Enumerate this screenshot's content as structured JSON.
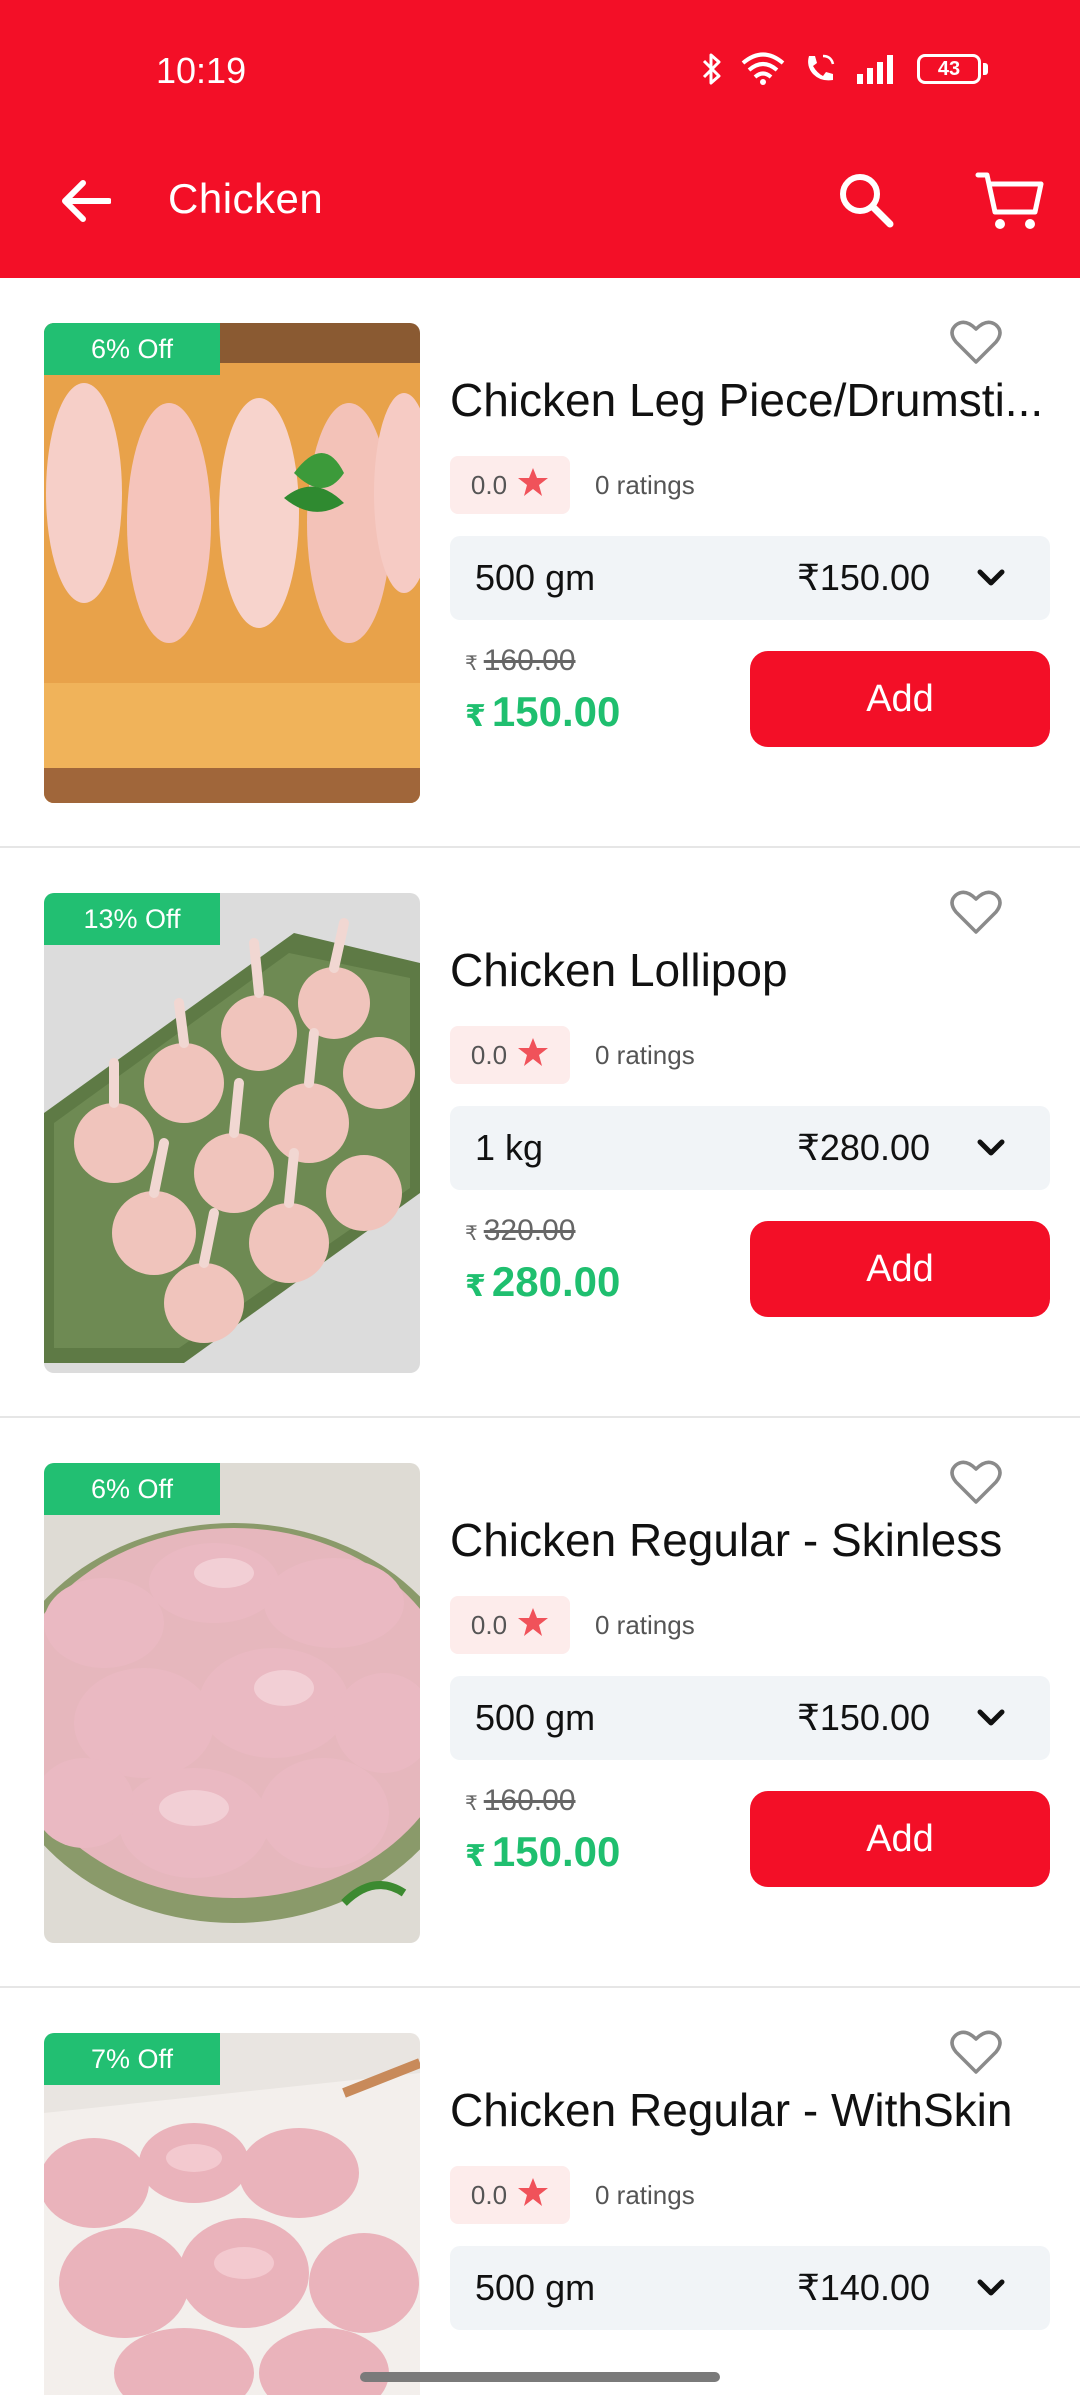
{
  "status_bar": {
    "time": "10:19",
    "battery": "43"
  },
  "toolbar": {
    "title": "Chicken"
  },
  "colors": {
    "brand": "#f30f27",
    "discount_badge": "#22bf72",
    "price_green": "#1fbf6f"
  },
  "products": [
    {
      "discount": "6% Off",
      "name": "Chicken Leg Piece/Drumsti...",
      "rating": "0.0",
      "ratings_label": "0 ratings",
      "variant_size": "500 gm",
      "variant_price": "₹150.00",
      "currency": "₹",
      "mrp": "160.00",
      "price": "150.00",
      "add_label": "Add"
    },
    {
      "discount": "13% Off",
      "name": "Chicken Lollipop",
      "rating": "0.0",
      "ratings_label": "0 ratings",
      "variant_size": "1 kg",
      "variant_price": "₹280.00",
      "currency": "₹",
      "mrp": "320.00",
      "price": "280.00",
      "add_label": "Add"
    },
    {
      "discount": "6% Off",
      "name": "Chicken Regular - Skinless",
      "rating": "0.0",
      "ratings_label": "0 ratings",
      "variant_size": "500 gm",
      "variant_price": "₹150.00",
      "currency": "₹",
      "mrp": "160.00",
      "price": "150.00",
      "add_label": "Add"
    },
    {
      "discount": "7% Off",
      "name": "Chicken Regular - WithSkin",
      "rating": "0.0",
      "ratings_label": "0 ratings",
      "variant_size": "500 gm",
      "variant_price": "₹140.00"
    }
  ]
}
